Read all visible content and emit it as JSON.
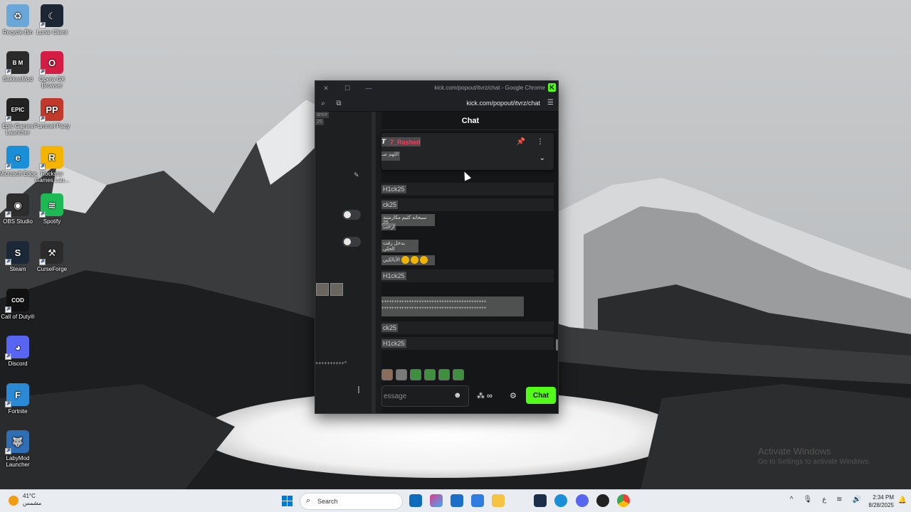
{
  "desktop": {
    "icons": [
      {
        "label": "Recycle Bin",
        "color": "#6ba6d9",
        "glyph": "♻"
      },
      {
        "label": "Lunar Client",
        "color": "#1d2733",
        "glyph": "☾"
      },
      {
        "label": "BakkesMod",
        "color": "#2b2b2b",
        "glyph": "B M"
      },
      {
        "label": "Opera GX Browser",
        "color": "#d41c44",
        "glyph": "O"
      },
      {
        "label": "Epic Games Launcher",
        "color": "#222222",
        "glyph": "EPIC"
      },
      {
        "label": "Pummel Party",
        "color": "#c0392b",
        "glyph": "PP"
      },
      {
        "label": "Microsoft Edge",
        "color": "#1a8fd8",
        "glyph": "e"
      },
      {
        "label": "Rockstar Games Lau...",
        "color": "#f4b400",
        "glyph": "R"
      },
      {
        "label": "OBS Studio",
        "color": "#2d2d2d",
        "glyph": "◉"
      },
      {
        "label": "Spotify",
        "color": "#1db954",
        "glyph": "≋"
      },
      {
        "label": "Steam",
        "color": "#1b2838",
        "glyph": "S"
      },
      {
        "label": "CurseForge",
        "color": "#2b2b2b",
        "glyph": "⚒"
      },
      {
        "label": "Call of Duty®",
        "color": "#111111",
        "glyph": "COD"
      },
      {
        "label": "Discord",
        "color": "#5865f2",
        "glyph": "◕"
      },
      {
        "label": "Fortnite",
        "color": "#2a8ad6",
        "glyph": "F"
      },
      {
        "label": "LabyMod Launcher",
        "color": "#2f6db5",
        "glyph": "🐺"
      }
    ]
  },
  "browser": {
    "window_title": "kick.com/popout/itvrz/chat - Google Chrome",
    "url": "kick.com/popout/itvrz/chat",
    "favicon": "K"
  },
  "left_pane": {
    "top_text": "ance",
    "top_text2": "25",
    "bottom_text": "++++++++++^"
  },
  "chat": {
    "header": "Chat",
    "pinned_user": "7_Rashed",
    "pinned_message": "اللهم صـ",
    "messages": [
      {
        "name": "H1ck25"
      },
      {
        "name": "ck25"
      },
      {
        "name": "H1ck25"
      },
      {
        "name": "ck25"
      },
      {
        "name": "H1ck25"
      }
    ],
    "arabic_1": "سبحانه كثيم مكارمتنة 25",
    "arabic_2": "ارحب",
    "arabic_3": "يدخل رفت الحلي",
    "arabic_4": "الأبالكبي",
    "plus_line_1": "++++++++++++++++++++++++++++++++++++++++++",
    "plus_line_2": "++++++++++++++++++++++++++++++++++++++++++",
    "input_placeholder": "essage",
    "send_label": "Chat"
  },
  "activate_windows": {
    "title": "Activate Windows",
    "subtitle": "Go to Settings to activate Windows."
  },
  "taskbar": {
    "weather_temp": "41°C",
    "weather_desc": "مشمس",
    "search_placeholder": "Search",
    "time": "2:34 PM",
    "date": "8/28/2025",
    "lang": "ع"
  }
}
